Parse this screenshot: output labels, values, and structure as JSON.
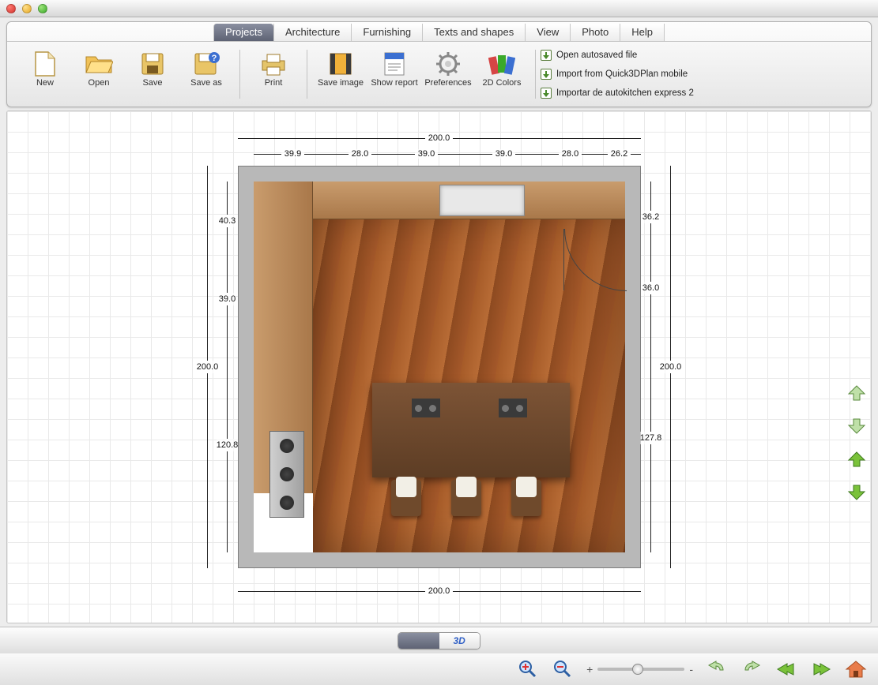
{
  "tabs": [
    "Projects",
    "Architecture",
    "Furnishing",
    "Texts and shapes",
    "View",
    "Photo",
    "Help"
  ],
  "active_tab": "Projects",
  "toolbar": {
    "new_label": "New",
    "open_label": "Open",
    "save_label": "Save",
    "saveas_label": "Save as",
    "print_label": "Print",
    "saveimage_label": "Save image",
    "showreport_label": "Show report",
    "prefs_label": "Preferences",
    "colors_label": "2D Colors"
  },
  "links": {
    "autosaved": "Open autosaved file",
    "import_mobile": "Import from Quick3DPlan mobile",
    "import_ak": "Importar de autokitchen express 2"
  },
  "dimensions": {
    "top_total": "200.0",
    "top_segs": [
      "39.9",
      "28.0",
      "39.0",
      "39.0",
      "28.0",
      "26.2"
    ],
    "bottom_total": "200.0",
    "left_total": "200.0",
    "left_segs": [
      "40.3",
      "39.0",
      "120.8"
    ],
    "right_total": "200.0",
    "right_segs": [
      "36.2",
      "36.0",
      "127.8"
    ]
  },
  "view_toggle": {
    "mode2d": "",
    "mode3d": "3D"
  },
  "slider": {
    "plus": "+",
    "minus": "-"
  }
}
